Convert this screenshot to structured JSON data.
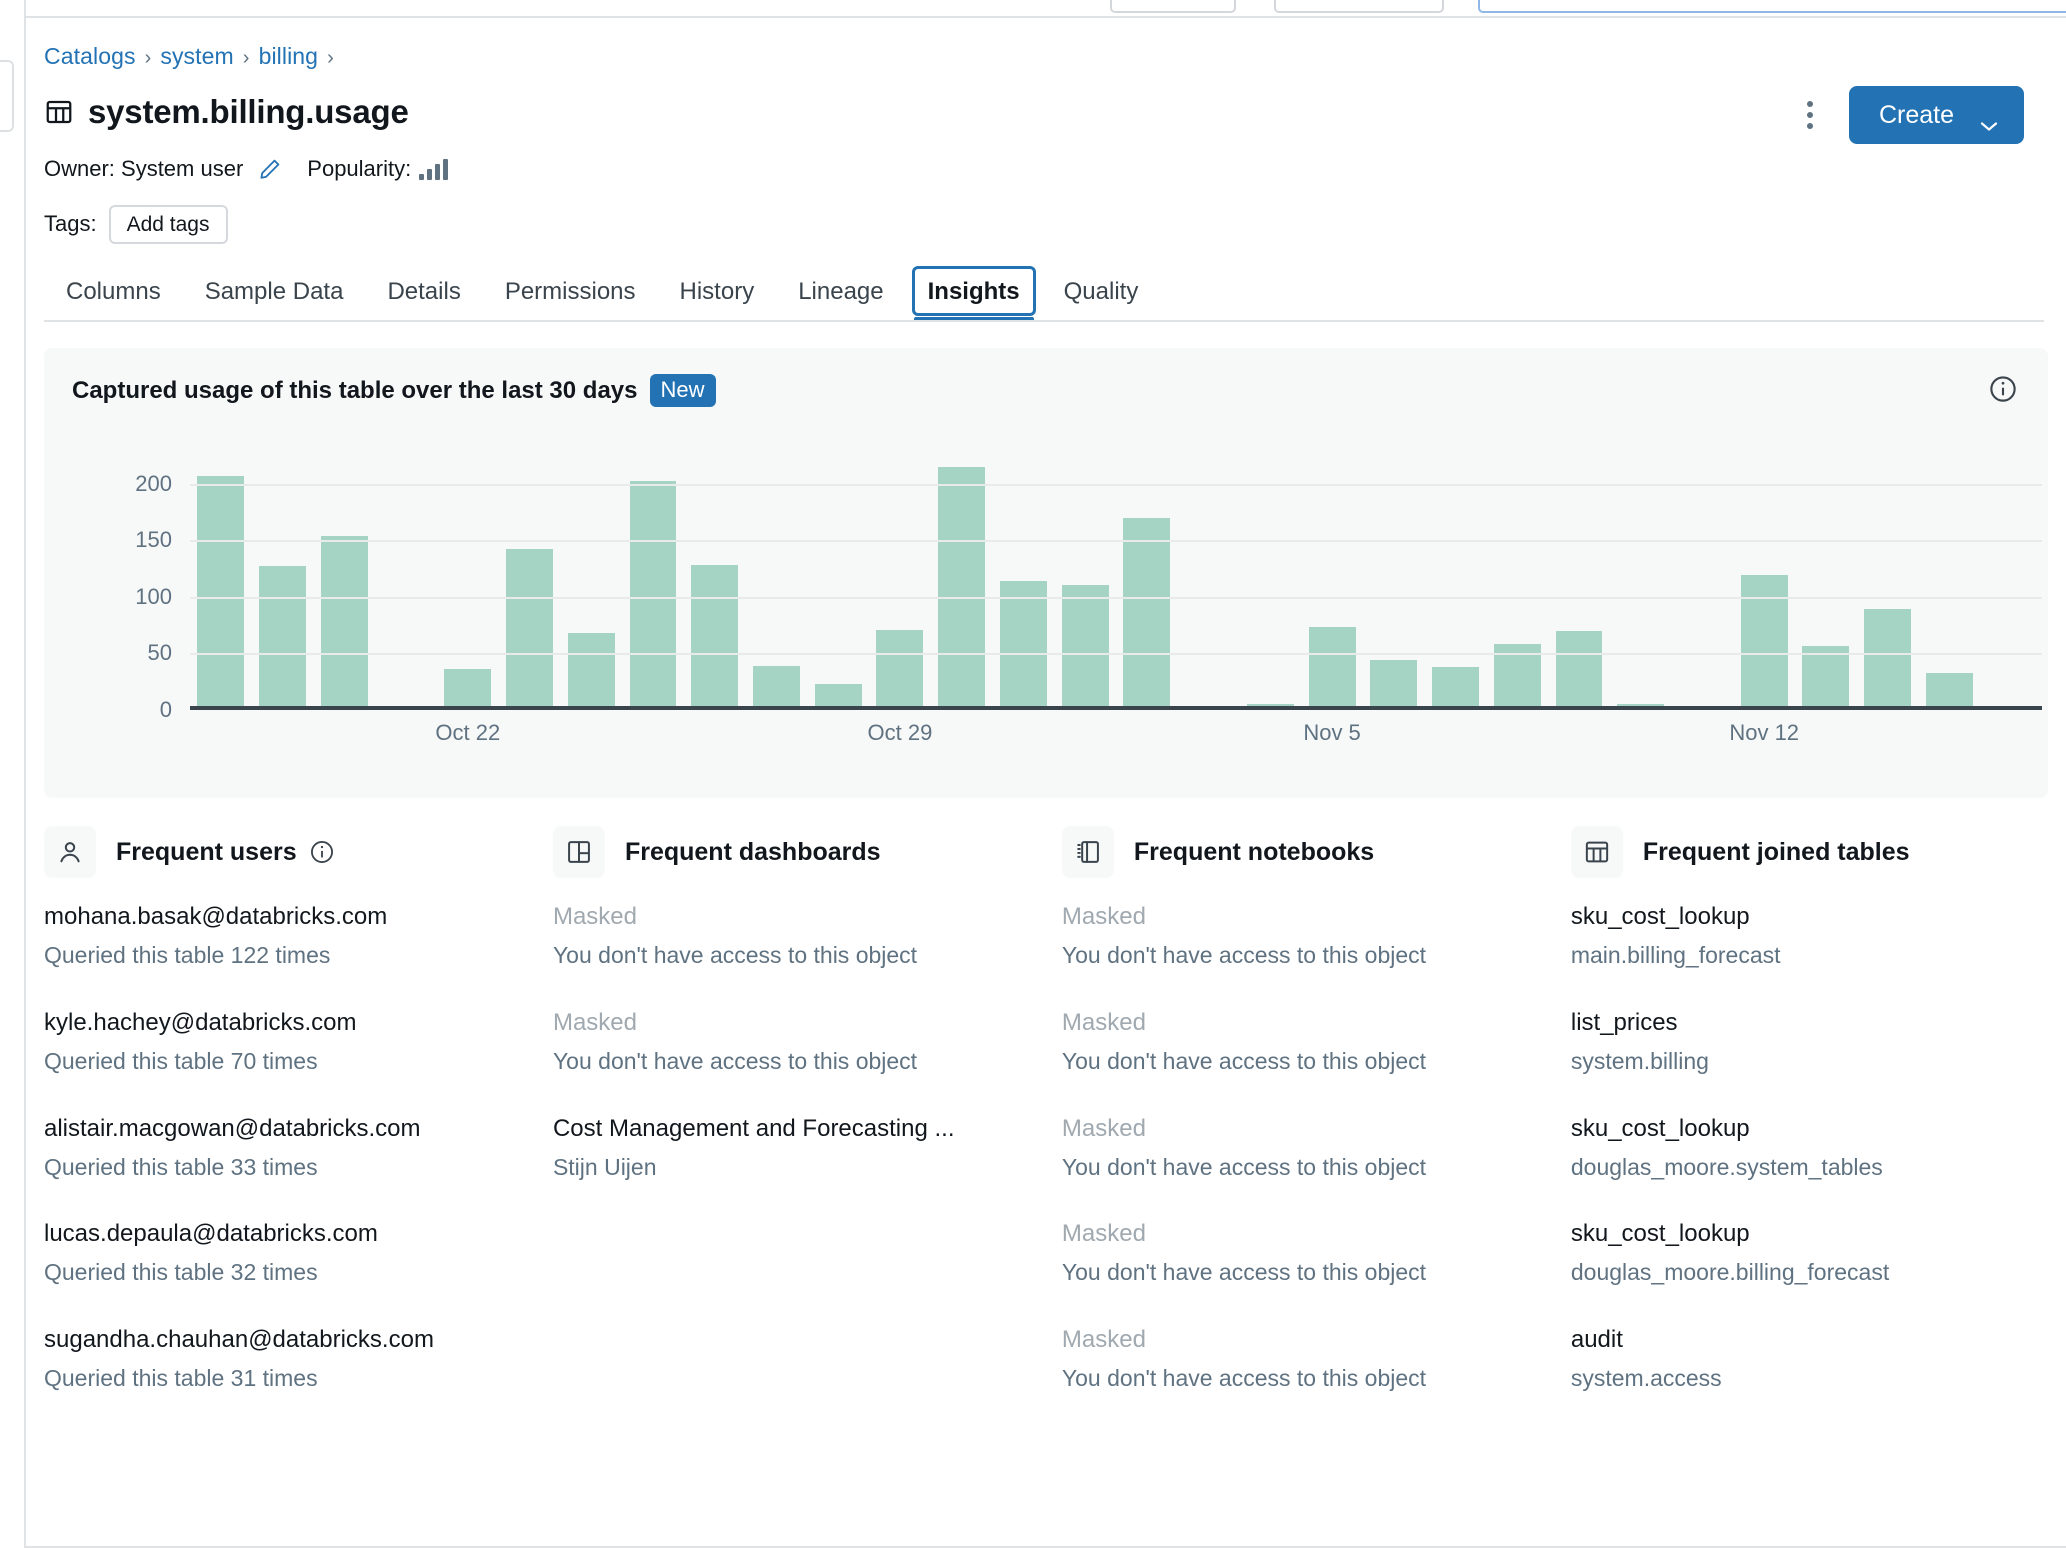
{
  "breadcrumb": {
    "items": [
      "Catalogs",
      "system",
      "billing"
    ],
    "separator": "›"
  },
  "header": {
    "title": "system.billing.usage",
    "title_icon": "table-icon",
    "owner_label": "Owner: System user",
    "edit_owner_icon": "pencil-icon",
    "popularity_label": "Popularity:",
    "popularity_icon": "signal-bars-icon",
    "tags_label": "Tags:",
    "add_tags_label": "Add tags",
    "kebab_icon": "more-vertical-icon",
    "create_label": "Create",
    "create_chevron_icon": "chevron-down-icon",
    "accent_color": "#2272b4"
  },
  "tabs": {
    "items": [
      {
        "label": "Columns",
        "active": false
      },
      {
        "label": "Sample Data",
        "active": false
      },
      {
        "label": "Details",
        "active": false
      },
      {
        "label": "Permissions",
        "active": false
      },
      {
        "label": "History",
        "active": false
      },
      {
        "label": "Lineage",
        "active": false
      },
      {
        "label": "Insights",
        "active": true
      },
      {
        "label": "Quality",
        "active": false
      }
    ]
  },
  "usage_card": {
    "title": "Captured usage of this table over the last 30 days",
    "badge": "New",
    "info_icon": "info-circle-icon"
  },
  "chart_data": {
    "type": "bar",
    "title": "Captured usage of this table over the last 30 days",
    "xlabel": "",
    "ylabel": "",
    "ylim": [
      0,
      230
    ],
    "yticks": [
      0,
      50,
      100,
      150,
      200
    ],
    "ytick_labels": [
      "0",
      "50",
      "100",
      "150",
      "200"
    ],
    "grid": true,
    "legend": "none",
    "bar_color": "#a6d4c4",
    "x_tick_labels": [
      "Oct 22",
      "Oct 29",
      "Nov 5",
      "Nov 12"
    ],
    "x_tick_indices": [
      4,
      11,
      18,
      25
    ],
    "categories": [
      "Oct 18",
      "Oct 19",
      "Oct 20",
      "Oct 21",
      "Oct 22",
      "Oct 23",
      "Oct 24",
      "Oct 25",
      "Oct 26",
      "Oct 27",
      "Oct 28",
      "Oct 29",
      "Oct 30",
      "Oct 31",
      "Nov 1",
      "Nov 2",
      "Nov 3",
      "Nov 4",
      "Nov 5",
      "Nov 6",
      "Nov 7",
      "Nov 8",
      "Nov 9",
      "Nov 10",
      "Nov 11",
      "Nov 12",
      "Nov 13",
      "Nov 14",
      "Nov 15",
      "Nov 16"
    ],
    "values": [
      207,
      127,
      154,
      0,
      36,
      142,
      68,
      203,
      128,
      39,
      23,
      71,
      215,
      114,
      111,
      170,
      2,
      5,
      73,
      44,
      38,
      58,
      70,
      5,
      2,
      119,
      57,
      89,
      33,
      0
    ]
  },
  "columns": [
    {
      "key": "users",
      "title": "Frequent users",
      "icon": "person-icon",
      "has_info": true,
      "info_icon": "info-circle-icon",
      "entries": [
        {
          "main": "mohana.basak@databricks.com",
          "sub": "Queried this table 122 times",
          "masked": false
        },
        {
          "main": "kyle.hachey@databricks.com",
          "sub": "Queried this table 70 times",
          "masked": false
        },
        {
          "main": "alistair.macgowan@databricks.com",
          "sub": "Queried this table 33 times",
          "masked": false
        },
        {
          "main": "lucas.depaula@databricks.com",
          "sub": "Queried this table 32 times",
          "masked": false
        },
        {
          "main": "sugandha.chauhan@databricks.com",
          "sub": "Queried this table 31 times",
          "masked": false
        }
      ]
    },
    {
      "key": "dashboards",
      "title": "Frequent dashboards",
      "icon": "dashboard-icon",
      "has_info": false,
      "entries": [
        {
          "main": "Masked",
          "sub": "You don't have access to this object",
          "masked": true
        },
        {
          "main": "Masked",
          "sub": "You don't have access to this object",
          "masked": true
        },
        {
          "main": "Cost Management and Forecasting ...",
          "sub": "Stijn Uijen",
          "masked": false
        }
      ]
    },
    {
      "key": "notebooks",
      "title": "Frequent notebooks",
      "icon": "notebook-icon",
      "has_info": false,
      "entries": [
        {
          "main": "Masked",
          "sub": "You don't have access to this object",
          "masked": true
        },
        {
          "main": "Masked",
          "sub": "You don't have access to this object",
          "masked": true
        },
        {
          "main": "Masked",
          "sub": "You don't have access to this object",
          "masked": true
        },
        {
          "main": "Masked",
          "sub": "You don't have access to this object",
          "masked": true
        },
        {
          "main": "Masked",
          "sub": "You don't have access to this object",
          "masked": true
        }
      ]
    },
    {
      "key": "joined",
      "title": "Frequent joined tables",
      "icon": "table-icon",
      "has_info": false,
      "entries": [
        {
          "main": "sku_cost_lookup",
          "sub": "main.billing_forecast",
          "masked": false
        },
        {
          "main": "list_prices",
          "sub": "system.billing",
          "masked": false
        },
        {
          "main": "sku_cost_lookup",
          "sub": "douglas_moore.system_tables",
          "masked": false
        },
        {
          "main": "sku_cost_lookup",
          "sub": "douglas_moore.billing_forecast",
          "masked": false
        },
        {
          "main": "audit",
          "sub": "system.access",
          "masked": false
        }
      ]
    }
  ]
}
